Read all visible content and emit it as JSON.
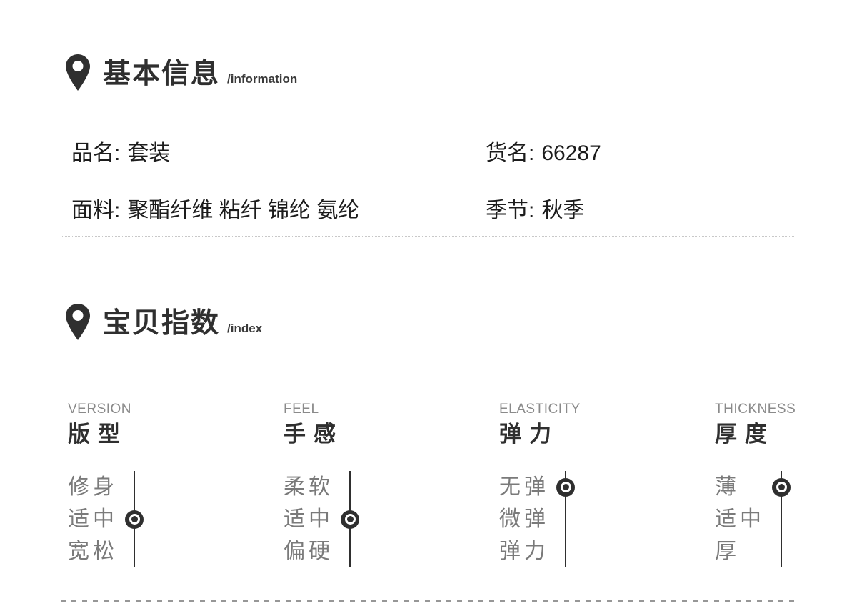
{
  "colors": {
    "accent_dark": "#2f2f2f",
    "text_primary": "#1c1c1c",
    "text_gray": "#7a7a7a",
    "label_gray": "#8a8a8a",
    "divider_dotted": "#c8c8c8",
    "divider_dashed": "#979797",
    "background": "#ffffff"
  },
  "sections": {
    "basic_info": {
      "title_cn": "基本信息",
      "title_en": "/information",
      "rows": [
        {
          "left": {
            "label": "品名:",
            "value": "套装"
          },
          "right": {
            "label": "货名:",
            "value": "66287"
          }
        },
        {
          "left": {
            "label": "面料:",
            "value": "聚酯纤维 粘纤 锦纶 氨纶"
          },
          "right": {
            "label": "季节:",
            "value": "秋季"
          }
        }
      ]
    },
    "index": {
      "title_cn": "宝贝指数",
      "title_en": "/index",
      "columns": [
        {
          "en": "VERSION",
          "cn": "版型",
          "options": [
            "修身",
            "适中",
            "宽松"
          ],
          "selected": 1
        },
        {
          "en": "FEEL",
          "cn": "手感",
          "options": [
            "柔软",
            "适中",
            "偏硬"
          ],
          "selected": 1
        },
        {
          "en": "ELASTICITY",
          "cn": "弹力",
          "options": [
            "无弹",
            "微弹",
            "弹力"
          ],
          "selected": 0
        },
        {
          "en": "THICKNESS",
          "cn": "厚度",
          "options": [
            "薄",
            "适中",
            "厚"
          ],
          "selected": 0
        }
      ]
    }
  }
}
